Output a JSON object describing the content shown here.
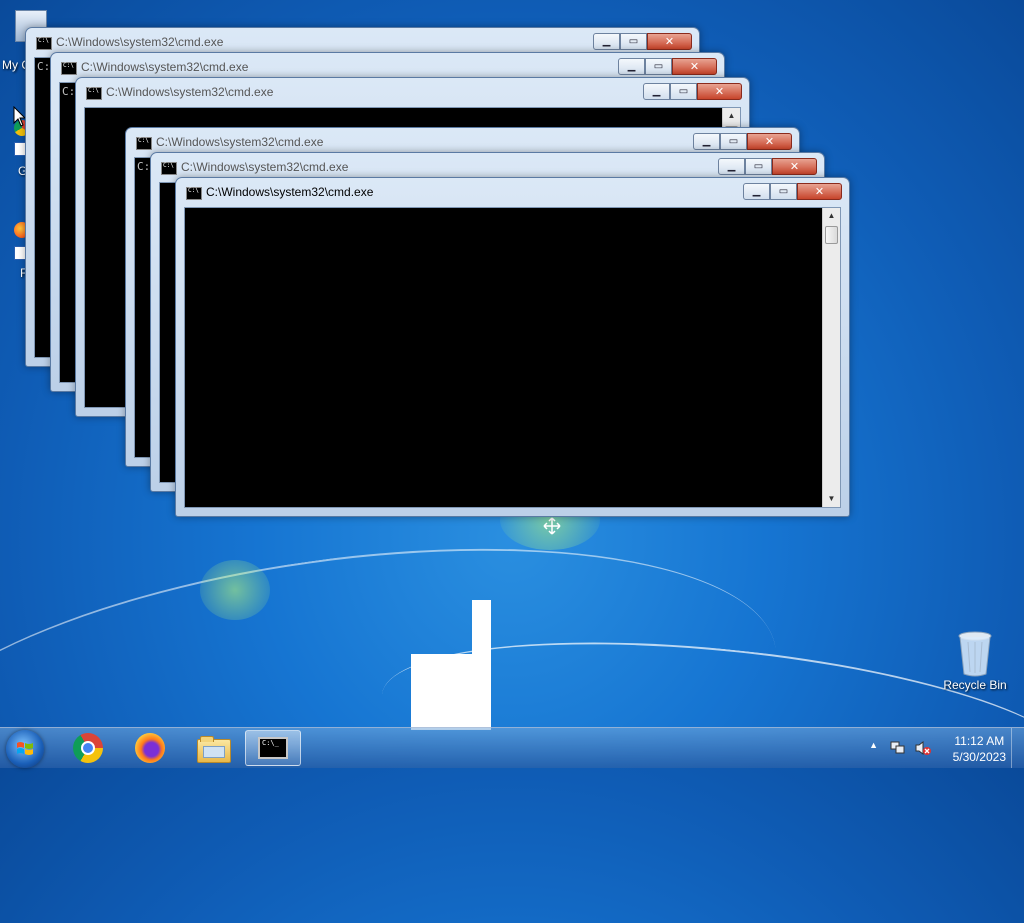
{
  "desktop": {
    "icons": [
      {
        "label": "My C"
      },
      {
        "label": "G C"
      },
      {
        "label": "F"
      },
      {
        "label": "Recycle Bin"
      }
    ]
  },
  "windows": [
    {
      "title": "C:\\Windows\\system32\\cmd.exe",
      "prompt": "C:",
      "state": "inactive"
    },
    {
      "title": "C:\\Windows\\system32\\cmd.exe",
      "prompt": "C:",
      "state": "inactive"
    },
    {
      "title": "C:\\Windows\\system32\\cmd.exe",
      "prompt": "",
      "state": "inactive"
    },
    {
      "title": "C:\\Windows\\system32\\cmd.exe",
      "prompt": "C:",
      "state": "inactive"
    },
    {
      "title": "C:\\Windows\\system32\\cmd.exe",
      "prompt": "",
      "state": "inactive"
    },
    {
      "title": "C:\\Windows\\system32\\cmd.exe",
      "prompt": "",
      "state": "active"
    }
  ],
  "taskbar": {
    "pinned": [
      "chrome-icon",
      "firefox-icon",
      "file-explorer-icon",
      "cmd-icon"
    ],
    "active_app": "cmd-icon"
  },
  "tray": {
    "time": "11:12 AM",
    "date": "5/30/2023",
    "icons": [
      "show-hidden-icons-arrow",
      "network-icon",
      "volume-muted-icon"
    ]
  },
  "colors": {
    "desktop_bg": "#1675d2",
    "window_frame": "#bcd0e8",
    "console_bg": "#000000",
    "close_button": "#c7442b"
  }
}
